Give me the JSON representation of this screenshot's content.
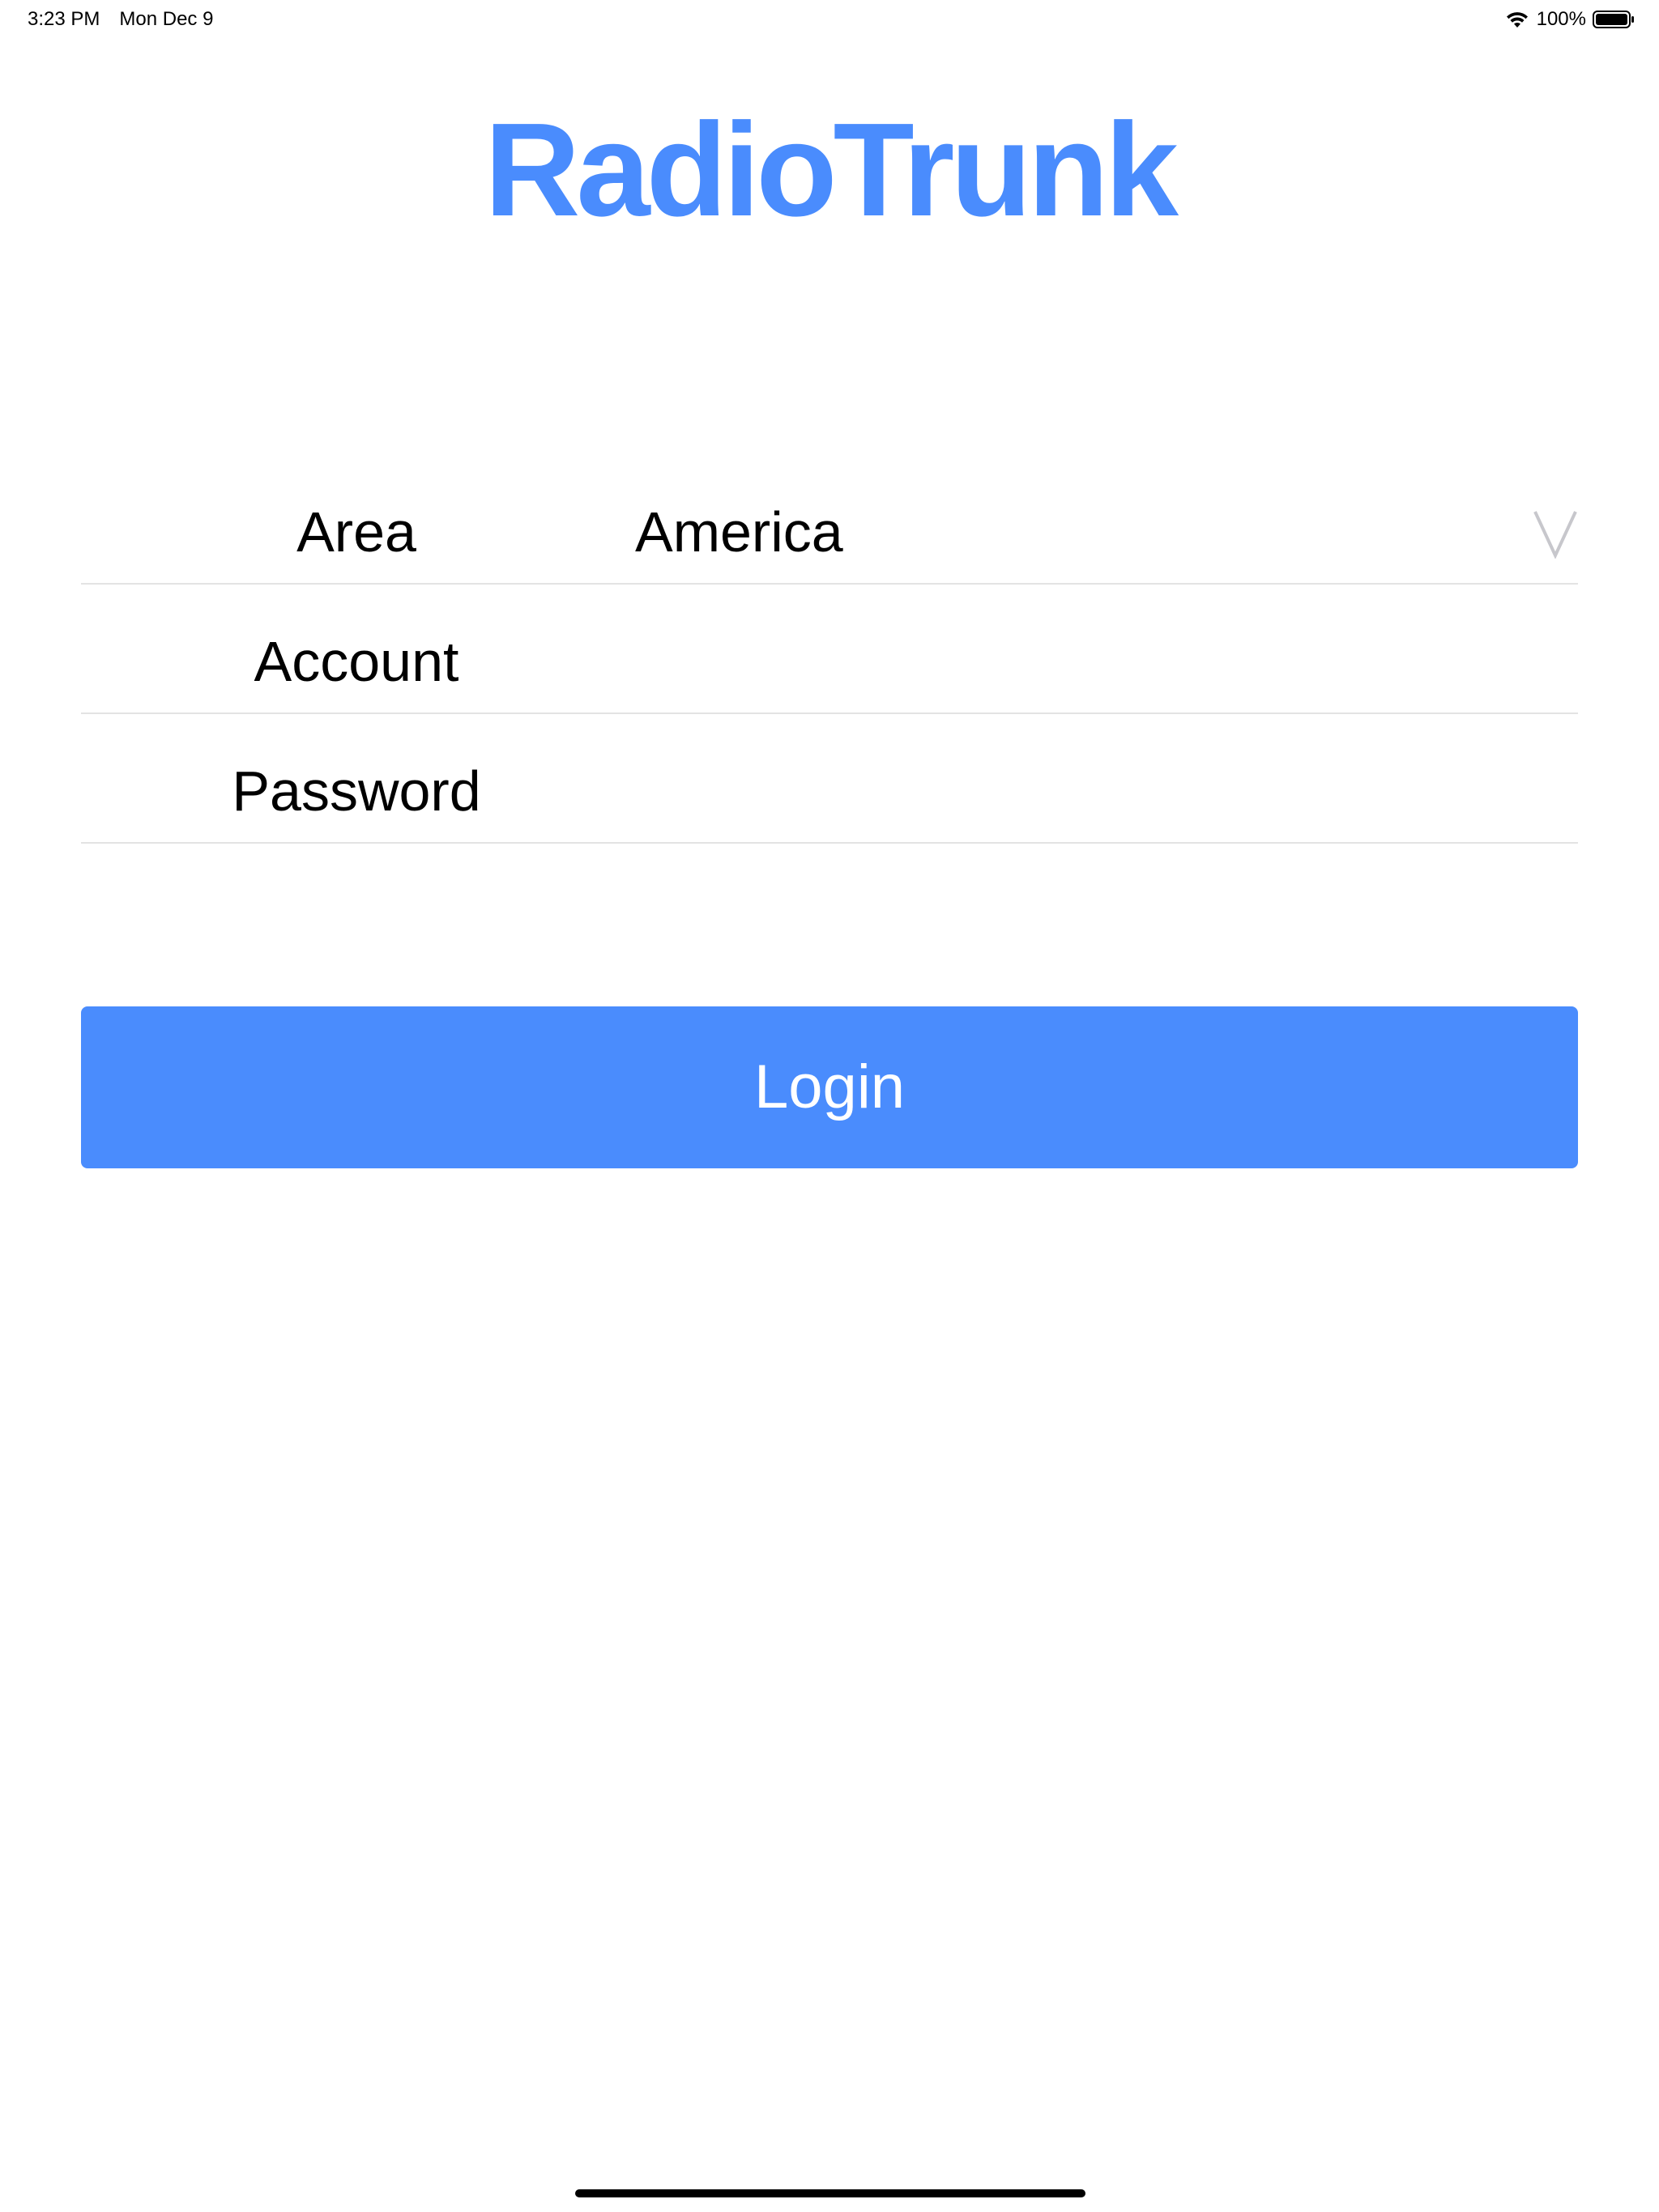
{
  "status_bar": {
    "time": "3:23 PM",
    "date": "Mon Dec 9",
    "battery_percent": "100%",
    "icons": [
      "wifi-icon",
      "battery-icon"
    ]
  },
  "app": {
    "title": "RadioTrunk",
    "accent_color": "#4a8cfd"
  },
  "form": {
    "area": {
      "label": "Area",
      "value": "America",
      "icon": "chevron-down-icon"
    },
    "account": {
      "label": "Account",
      "value": "",
      "placeholder": ""
    },
    "password": {
      "label": "Password",
      "value": "",
      "placeholder": ""
    }
  },
  "login_button": {
    "label": "Login"
  }
}
